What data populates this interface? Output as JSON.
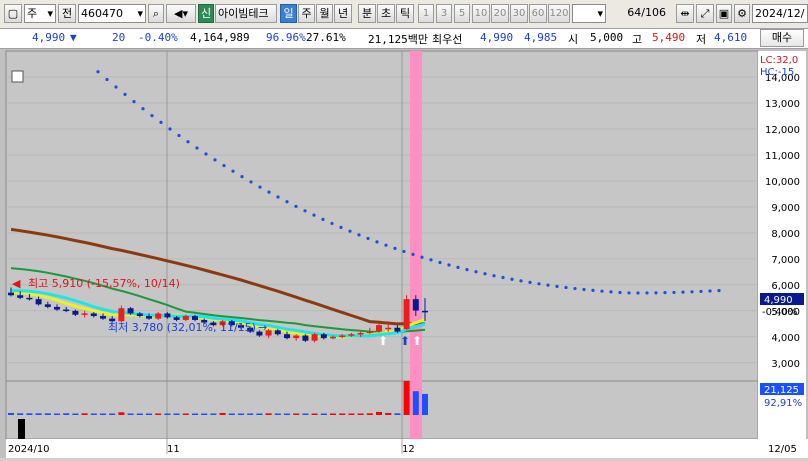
{
  "toolbar": {
    "market_select": "주",
    "market_type": "전",
    "code": "460470",
    "company_badge": "신",
    "company_name": "아이빔테크",
    "periods": [
      "일",
      "주",
      "월",
      "년",
      "분",
      "초",
      "틱"
    ],
    "selected_period": "일",
    "intervals": [
      "1",
      "3",
      "5",
      "10",
      "20",
      "30",
      "60",
      "120"
    ],
    "count": "64",
    "total": "/106",
    "date": "2024/12/"
  },
  "quote": {
    "price": "4,990",
    "change_arrow": "▼",
    "change": "20",
    "change_pct": "-0.40%",
    "volume": "4,164,989",
    "vol_ratio": "96.96%",
    "turnover": "27.61%",
    "amount": "21,125백만",
    "best_label": "최우선",
    "ask": "4,990",
    "bid": "4,985",
    "open_label": "시",
    "open": "5,000",
    "high_label": "고",
    "high": "5,490",
    "low_label": "저",
    "low": "4,610",
    "buy_button": "매수"
  },
  "chart_data": {
    "type": "candlestick",
    "x": [
      "2024/10",
      "11",
      "12",
      "12/05"
    ],
    "y_ticks": [
      3000,
      4000,
      5000,
      6000,
      7000,
      8000,
      9000,
      10000,
      11000,
      12000,
      13000,
      14000
    ],
    "y_ticks_label": [
      "3,000",
      "4,000",
      "5,000",
      "6,000",
      "7,000",
      "8,000",
      "9,000",
      "10,000",
      "11,000",
      "12,000",
      "13,000",
      "14,000"
    ],
    "ylim": [
      2300,
      15000
    ],
    "lc": "LC:32,0",
    "hc": "HC:-15,",
    "last_price_label": "4,990",
    "last_change_label": "-0.40%",
    "high_annotation": "최고 5,910 (-15,57%, 10/14)",
    "low_annotation": "최저 3,780 (32,01%, 11/15)",
    "volume_label": "21,125",
    "volume_pct_label": "92,91%",
    "candles": [
      {
        "o": 5700,
        "h": 5900,
        "l": 5550,
        "c": 5600
      },
      {
        "o": 5600,
        "h": 5750,
        "l": 5450,
        "c": 5500
      },
      {
        "o": 5500,
        "h": 5650,
        "l": 5400,
        "c": 5450
      },
      {
        "o": 5450,
        "h": 5550,
        "l": 5200,
        "c": 5250
      },
      {
        "o": 5250,
        "h": 5350,
        "l": 5100,
        "c": 5150
      },
      {
        "o": 5150,
        "h": 5250,
        "l": 5000,
        "c": 5050
      },
      {
        "o": 5050,
        "h": 5150,
        "l": 4950,
        "c": 5000
      },
      {
        "o": 5000,
        "h": 5050,
        "l": 4800,
        "c": 4850
      },
      {
        "o": 4850,
        "h": 5000,
        "l": 4750,
        "c": 4900
      },
      {
        "o": 4900,
        "h": 4950,
        "l": 4750,
        "c": 4800
      },
      {
        "o": 4800,
        "h": 4900,
        "l": 4650,
        "c": 4700
      },
      {
        "o": 4700,
        "h": 4800,
        "l": 4550,
        "c": 4600
      },
      {
        "o": 4600,
        "h": 5200,
        "l": 4550,
        "c": 5100
      },
      {
        "o": 5100,
        "h": 5150,
        "l": 4850,
        "c": 4900
      },
      {
        "o": 4900,
        "h": 4950,
        "l": 4750,
        "c": 4800
      },
      {
        "o": 4800,
        "h": 4900,
        "l": 4650,
        "c": 4700
      },
      {
        "o": 4700,
        "h": 4950,
        "l": 4650,
        "c": 4900
      },
      {
        "o": 4900,
        "h": 4950,
        "l": 4700,
        "c": 4750
      },
      {
        "o": 4750,
        "h": 4800,
        "l": 4600,
        "c": 4650
      },
      {
        "o": 4650,
        "h": 4850,
        "l": 4600,
        "c": 4800
      },
      {
        "o": 4800,
        "h": 4850,
        "l": 4600,
        "c": 4650
      },
      {
        "o": 4650,
        "h": 4700,
        "l": 4500,
        "c": 4550
      },
      {
        "o": 4550,
        "h": 4600,
        "l": 4400,
        "c": 4450
      },
      {
        "o": 4450,
        "h": 4650,
        "l": 4400,
        "c": 4600
      },
      {
        "o": 4600,
        "h": 4650,
        "l": 4400,
        "c": 4450
      },
      {
        "o": 4450,
        "h": 4500,
        "l": 4300,
        "c": 4350
      },
      {
        "o": 4350,
        "h": 4400,
        "l": 4150,
        "c": 4200
      },
      {
        "o": 4200,
        "h": 4250,
        "l": 4000,
        "c": 4050
      },
      {
        "o": 4050,
        "h": 4300,
        "l": 3950,
        "c": 4250
      },
      {
        "o": 4250,
        "h": 4300,
        "l": 4050,
        "c": 4100
      },
      {
        "o": 4100,
        "h": 4200,
        "l": 3900,
        "c": 3950
      },
      {
        "o": 3950,
        "h": 4100,
        "l": 3850,
        "c": 4050
      },
      {
        "o": 4050,
        "h": 4100,
        "l": 3800,
        "c": 3850
      },
      {
        "o": 3850,
        "h": 4150,
        "l": 3780,
        "c": 4100
      },
      {
        "o": 4100,
        "h": 4150,
        "l": 3900,
        "c": 3950
      },
      {
        "o": 3950,
        "h": 4050,
        "l": 3900,
        "c": 4000
      },
      {
        "o": 4000,
        "h": 4100,
        "l": 3950,
        "c": 4050
      },
      {
        "o": 4050,
        "h": 4150,
        "l": 4000,
        "c": 4100
      },
      {
        "o": 4100,
        "h": 4200,
        "l": 4000,
        "c": 4150
      },
      {
        "o": 4150,
        "h": 4350,
        "l": 4100,
        "c": 4200
      },
      {
        "o": 4200,
        "h": 4500,
        "l": 4150,
        "c": 4450
      },
      {
        "o": 4300,
        "h": 4600,
        "l": 4200,
        "c": 4350
      },
      {
        "o": 4350,
        "h": 4450,
        "l": 4150,
        "c": 4200
      },
      {
        "o": 4300,
        "h": 5600,
        "l": 4250,
        "c": 5450
      },
      {
        "o": 5450,
        "h": 5600,
        "l": 4800,
        "c": 5010
      },
      {
        "o": 5000,
        "h": 5490,
        "l": 4610,
        "c": 4990
      }
    ],
    "volumes": [
      6,
      5,
      5,
      5,
      5,
      4,
      5,
      4,
      5,
      4,
      4,
      4,
      8,
      4,
      3,
      3,
      4,
      3,
      3,
      4,
      3,
      3,
      3,
      6,
      3,
      3,
      3,
      3,
      5,
      3,
      3,
      4,
      3,
      4,
      3,
      3,
      3,
      4,
      4,
      5,
      9,
      6,
      5,
      100,
      70,
      62
    ],
    "colors": {
      "up": "#ee1c1c",
      "down": "#0a1a8c",
      "ma_long": "#8b3a0e",
      "ma_mid": "#1a9a3a",
      "ma_cyan": "#19e6f0",
      "ma_yellow": "#f0f020",
      "dots": "#1a4fe0",
      "highlight": "#ff8fc0",
      "vol_red": "#ff0000",
      "vol_blue": "#1a50ff"
    }
  }
}
